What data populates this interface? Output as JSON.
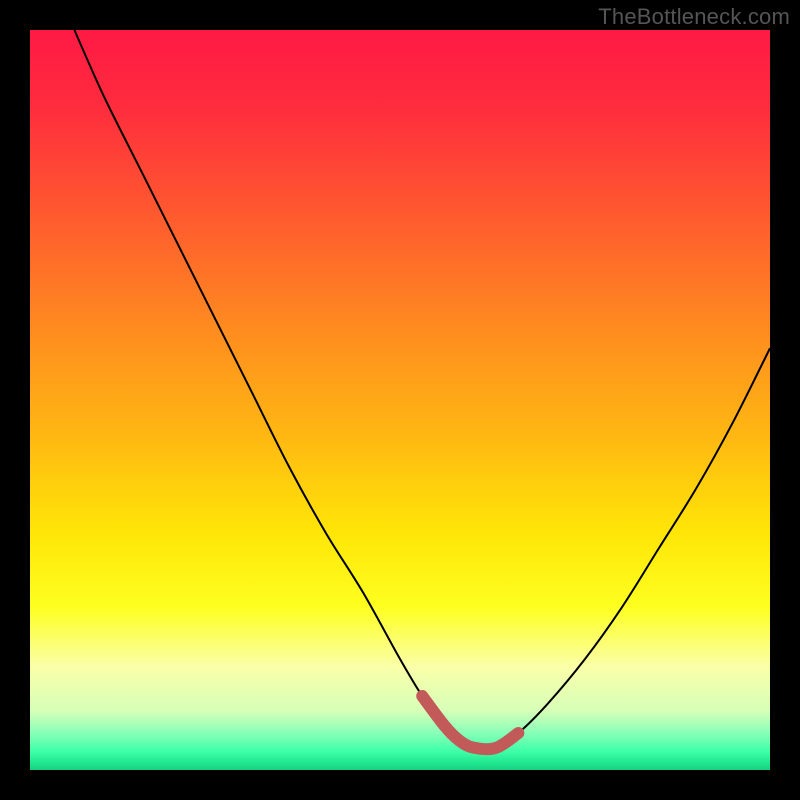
{
  "branding": {
    "watermark": "TheBottleneck.com"
  },
  "chart_data": {
    "type": "line",
    "title": "",
    "xlabel": "",
    "ylabel": "",
    "xlim": [
      0,
      100
    ],
    "ylim": [
      0,
      100
    ],
    "background_gradient_stops": [
      {
        "pos": 0,
        "color": "#ff1a44"
      },
      {
        "pos": 25,
        "color": "#ff5a2f"
      },
      {
        "pos": 55,
        "color": "#ffb812"
      },
      {
        "pos": 78,
        "color": "#feff20"
      },
      {
        "pos": 95,
        "color": "#88ffb8"
      },
      {
        "pos": 100,
        "color": "#18d080"
      }
    ],
    "series": [
      {
        "name": "bottleneck-curve",
        "x": [
          6,
          10,
          15,
          20,
          25,
          30,
          35,
          40,
          45,
          50,
          53,
          56,
          58,
          60,
          63,
          66,
          70,
          75,
          80,
          85,
          90,
          95,
          100
        ],
        "y": [
          100,
          91,
          81,
          71,
          61,
          51,
          41,
          32,
          24,
          15,
          10,
          6,
          4,
          3,
          3,
          5,
          9,
          15,
          22,
          30,
          38,
          47,
          57
        ]
      },
      {
        "name": "optimal-range-highlight",
        "x": [
          53,
          56,
          58,
          60,
          63,
          66
        ],
        "y": [
          10,
          6,
          4,
          3,
          3,
          5
        ]
      }
    ],
    "note": "Values estimated from pixel positions; no axis ticks or numeric labels are visible in the image."
  }
}
